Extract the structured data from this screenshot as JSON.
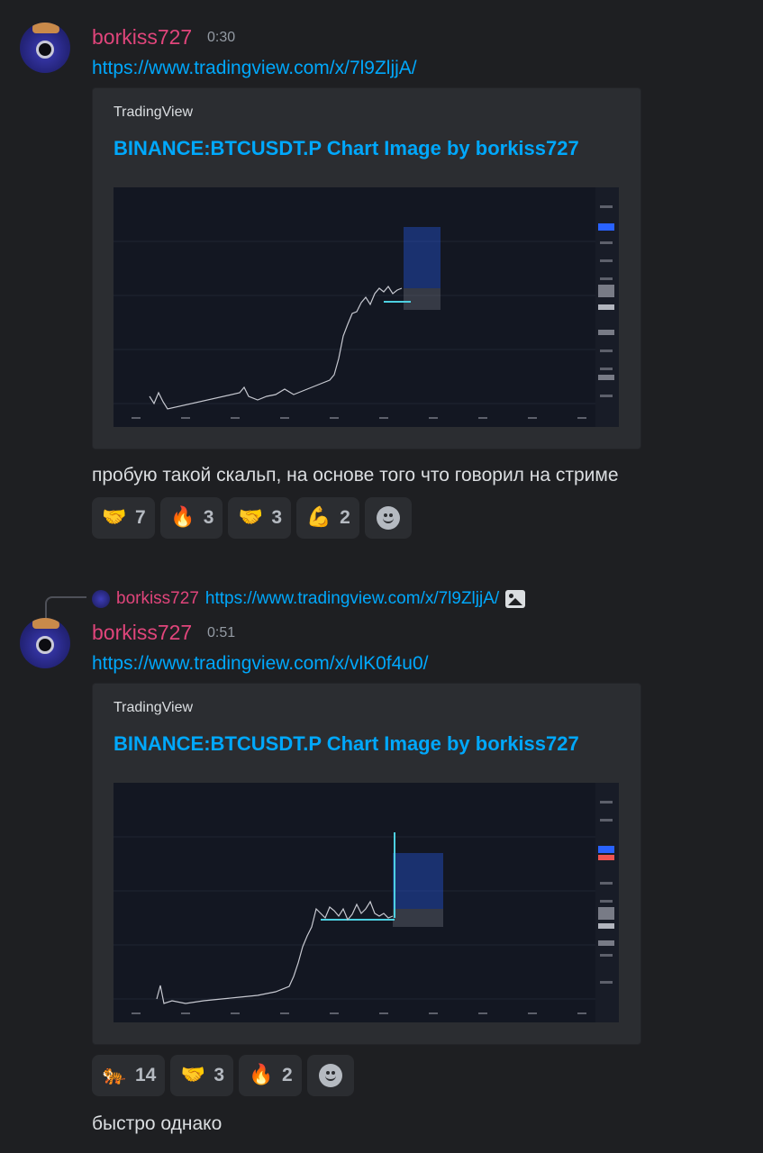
{
  "messages": [
    {
      "username": "borkiss727",
      "timestamp": "0:30",
      "link": "https://www.tradingview.com/x/7l9ZljjA/",
      "embed": {
        "provider": "TradingView",
        "title": "BINANCE:BTCUSDT.P Chart Image by borkiss727"
      },
      "text": "пробую такой скальп, на основе того что говорил на стриме",
      "reactions": [
        {
          "emoji": "🤝",
          "icon": "handshake-icon",
          "count": "7"
        },
        {
          "emoji": "🔥",
          "icon": "blue-fire-icon",
          "count": "3"
        },
        {
          "emoji": "🤝",
          "icon": "handshake-icon",
          "count": "3"
        },
        {
          "emoji": "💪",
          "icon": "flexed-biceps-icon",
          "count": "2"
        }
      ]
    },
    {
      "reply": {
        "username": "borkiss727",
        "link": "https://www.tradingview.com/x/7l9ZljjA/"
      },
      "username": "borkiss727",
      "timestamp": "0:51",
      "link": "https://www.tradingview.com/x/vlK0f4u0/",
      "embed": {
        "provider": "TradingView",
        "title": "BINANCE:BTCUSDT.P Chart Image by borkiss727"
      },
      "reactions": [
        {
          "emoji": "🐅",
          "icon": "tiger-icon",
          "count": "14"
        },
        {
          "emoji": "🤝",
          "icon": "handshake-icon",
          "count": "3"
        },
        {
          "emoji": "🔥",
          "icon": "fire-icon",
          "count": "2"
        }
      ],
      "text": "быстро однако"
    }
  ],
  "colors": {
    "background": "#1e1f22",
    "embed_bg": "#2b2d31",
    "username": "#e0457b",
    "link": "#00a8fc",
    "chart_bg": "#131722",
    "position_blue": "#2962ff",
    "position_gray": "#787b86"
  }
}
